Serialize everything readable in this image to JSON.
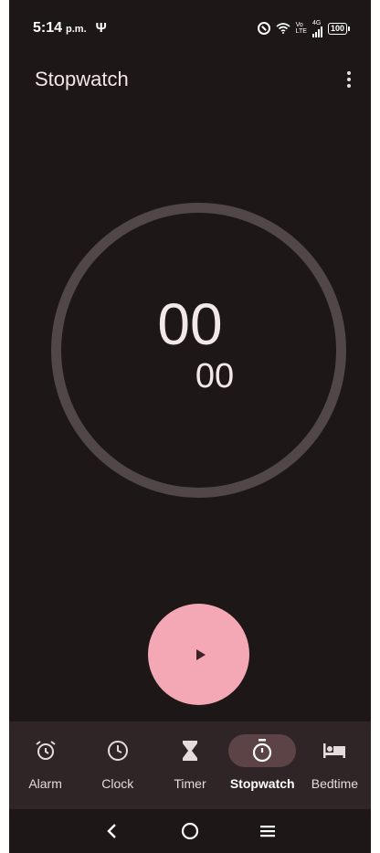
{
  "status_bar": {
    "time": "5:14",
    "ampm": "p.m.",
    "volte_top": "Vo",
    "volte_bottom": "LTE",
    "network": "4G",
    "battery": "100"
  },
  "app_bar": {
    "title": "Stopwatch",
    "overflow_icon": "more-vert-icon"
  },
  "stopwatch": {
    "seconds": "00",
    "hundredths": "00",
    "play_icon": "play-icon"
  },
  "bottom_nav": {
    "items": [
      {
        "label": "Alarm",
        "icon": "alarm-icon"
      },
      {
        "label": "Clock",
        "icon": "clock-icon"
      },
      {
        "label": "Timer",
        "icon": "hourglass-icon"
      },
      {
        "label": "Stopwatch",
        "icon": "stopwatch-icon",
        "active": true
      },
      {
        "label": "Bedtime",
        "icon": "bed-icon"
      }
    ]
  },
  "system_nav": {
    "back_icon": "back-icon",
    "home_icon": "home-icon",
    "recents_icon": "menu-icon"
  },
  "colors": {
    "background": "#1e1718",
    "accent": "#f4a8b6",
    "dial_ring": "#514748",
    "nav_background": "#2f2526",
    "active_indicator": "#5c4346"
  }
}
